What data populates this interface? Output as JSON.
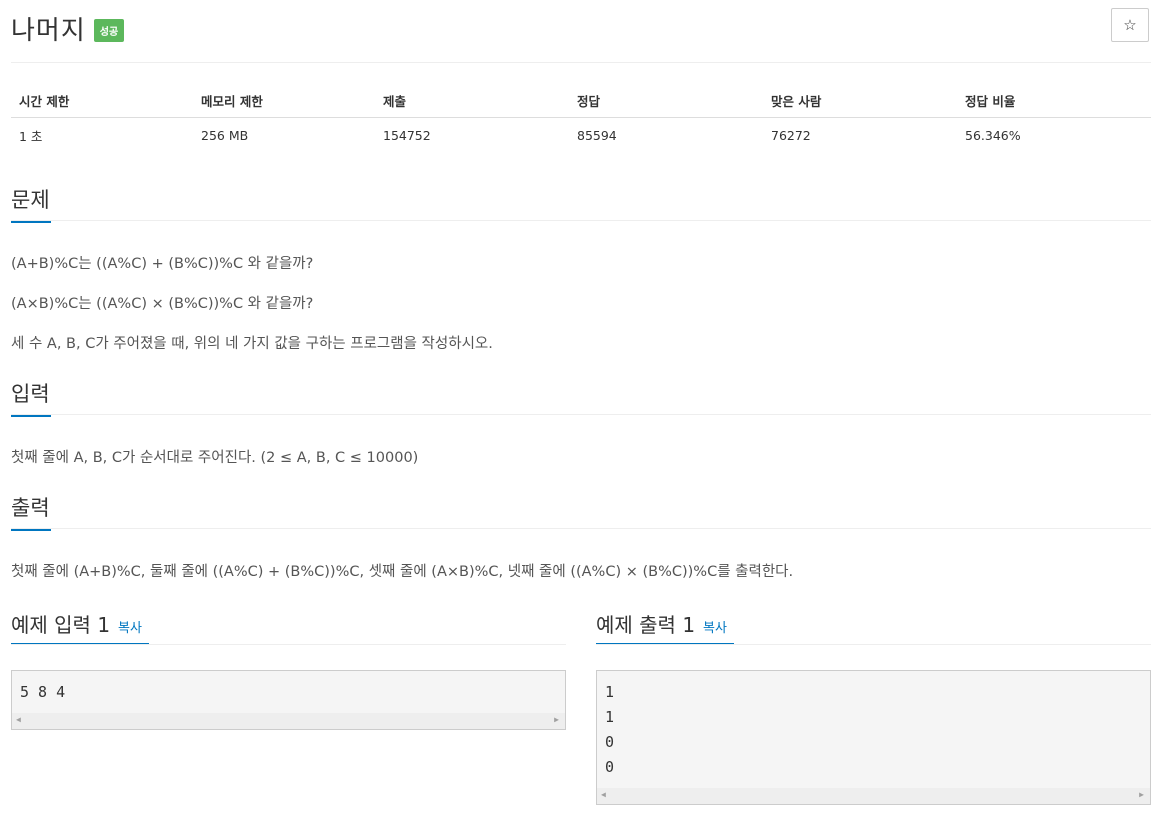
{
  "problem": {
    "title": "나머지",
    "status_badge": "성공",
    "star_icon": "☆"
  },
  "stats": {
    "headers": [
      "시간 제한",
      "메모리 제한",
      "제출",
      "정답",
      "맞은 사람",
      "정답 비율"
    ],
    "values": [
      "1 초",
      "256 MB",
      "154752",
      "85594",
      "76272",
      "56.346%"
    ]
  },
  "sections": {
    "problem": {
      "title": "문제",
      "lines": [
        "(A+B)%C는 ((A%C) + (B%C))%C 와 같을까?",
        "(A×B)%C는 ((A%C) × (B%C))%C 와 같을까?",
        "세 수 A, B, C가 주어졌을 때, 위의 네 가지 값을 구하는 프로그램을 작성하시오."
      ]
    },
    "input": {
      "title": "입력",
      "text": "첫째 줄에 A, B, C가 순서대로 주어진다. (2 ≤ A, B, C ≤ 10000)"
    },
    "output": {
      "title": "출력",
      "text": "첫째 줄에 (A+B)%C, 둘째 줄에 ((A%C) + (B%C))%C, 셋째 줄에 (A×B)%C, 넷째 줄에 ((A%C) × (B%C))%C를 출력한다."
    }
  },
  "samples": {
    "input": {
      "title": "예제 입력 1",
      "copy_label": "복사",
      "content": "5 8 4"
    },
    "output": {
      "title": "예제 출력 1",
      "copy_label": "복사",
      "content": "1\n1\n0\n0"
    }
  },
  "colors": {
    "accent": "#0076c0",
    "success_badge": "#5cb85c"
  }
}
